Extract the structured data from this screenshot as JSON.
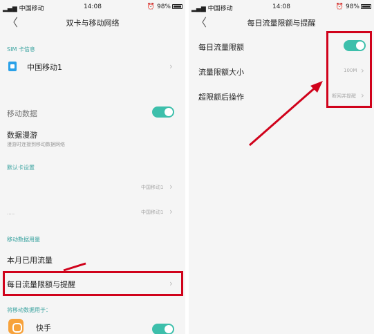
{
  "status_bar": {
    "carrier": "中国移动",
    "time": "14:08",
    "battery": "98%"
  },
  "left": {
    "title": "双卡与移动网络",
    "sim_section": "SIM 卡信息",
    "sim1": "中国移动1",
    "mobile_data": "移动数据",
    "roaming": "数据漫游",
    "roaming_sub": "漫游时连接到移动数据网络",
    "default_section": "默认卡设置",
    "default_val1": "中国移动1",
    "default_val2": "中国移动1",
    "usage_section": "移动数据用量",
    "month_used": "本月已用流量",
    "daily_limit": "每日流量限额与提醒",
    "use_for_section": "将移动数据用于：",
    "app_name": "快手"
  },
  "right": {
    "title": "每日流量限额与提醒",
    "daily_limit": "每日流量限额",
    "limit_size": "流量限额大小",
    "limit_size_value": "100M",
    "over_action": "超限额后操作",
    "over_action_value": "断网并提醒"
  },
  "colors": {
    "accent": "#3dbfab",
    "highlight": "#d0021b"
  }
}
